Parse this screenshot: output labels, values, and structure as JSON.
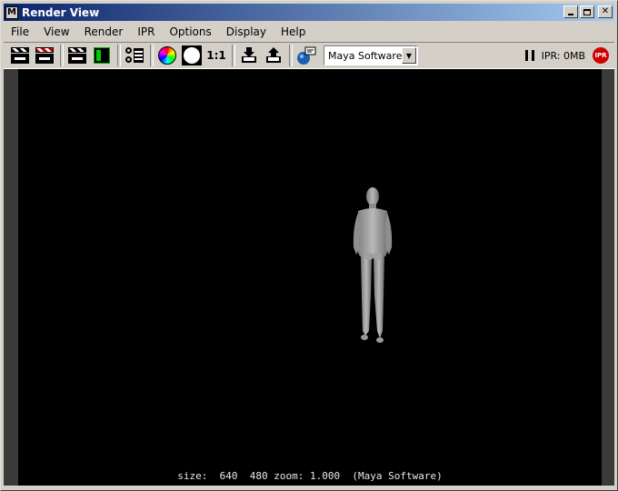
{
  "window": {
    "title": "Render View"
  },
  "menu": [
    {
      "label": "File"
    },
    {
      "label": "View"
    },
    {
      "label": "Render"
    },
    {
      "label": "IPR"
    },
    {
      "label": "Options"
    },
    {
      "label": "Display"
    },
    {
      "label": "Help"
    }
  ],
  "toolbar": {
    "one_to_one_label": "1:1",
    "renderer_value": "Maya Software",
    "ipr_memory": "IPR: 0MB",
    "icons": [
      "redo-render-icon",
      "render-region-icon",
      "ipr-render-icon",
      "refresh-ipr-icon",
      "render-settings-icon",
      "rgb-channel-icon",
      "alpha-channel-icon",
      "real-size-icon",
      "keep-image-icon",
      "remove-image-icon",
      "render-globals-icon",
      "pause-icon",
      "stop-ipr-icon"
    ]
  },
  "viewport": {
    "status_text": "size:  640  480 zoom: 1.000  (Maya Software)"
  }
}
